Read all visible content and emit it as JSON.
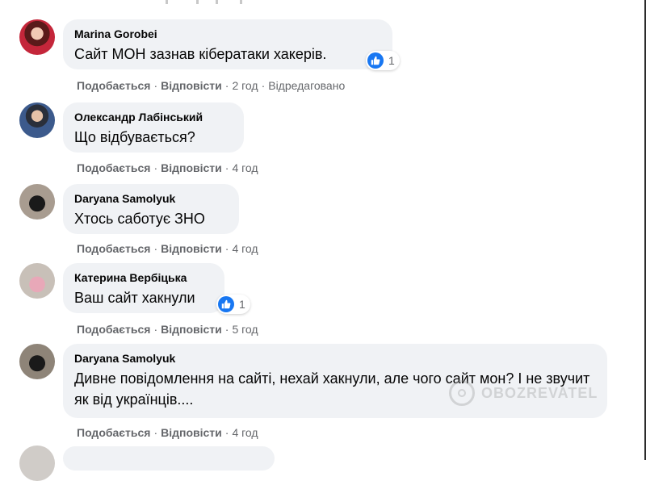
{
  "actions": {
    "like": "Подобається",
    "reply": "Відповісти",
    "separator": "·"
  },
  "comments": [
    {
      "author": "Marina Gorobei",
      "text": "Сайт МОН зазнав кібератаки хакерів.",
      "time": "2 год",
      "edited": "Відредаговано",
      "reactions": "1"
    },
    {
      "author": "Олександр Лабінський",
      "text": "Що відбувається?",
      "time": "4 год"
    },
    {
      "author": "Daryana Samolyuk",
      "text": "Хтось саботує ЗНО",
      "time": "4 год"
    },
    {
      "author": "Катерина Вербіцька",
      "text": "Ваш сайт хакнули",
      "time": "5 год",
      "reactions": "1"
    },
    {
      "author": "Daryana Samolyuk",
      "text": "Дивне повідомлення на сайті, нехай хакнули, але чого сайт мон? І не звучит як від українців....",
      "time": "4 год"
    }
  ],
  "watermark": "OBOZREVATEL",
  "colors": {
    "bubble": "#f0f2f5",
    "meta": "#65676b",
    "like": "#1877f2"
  }
}
